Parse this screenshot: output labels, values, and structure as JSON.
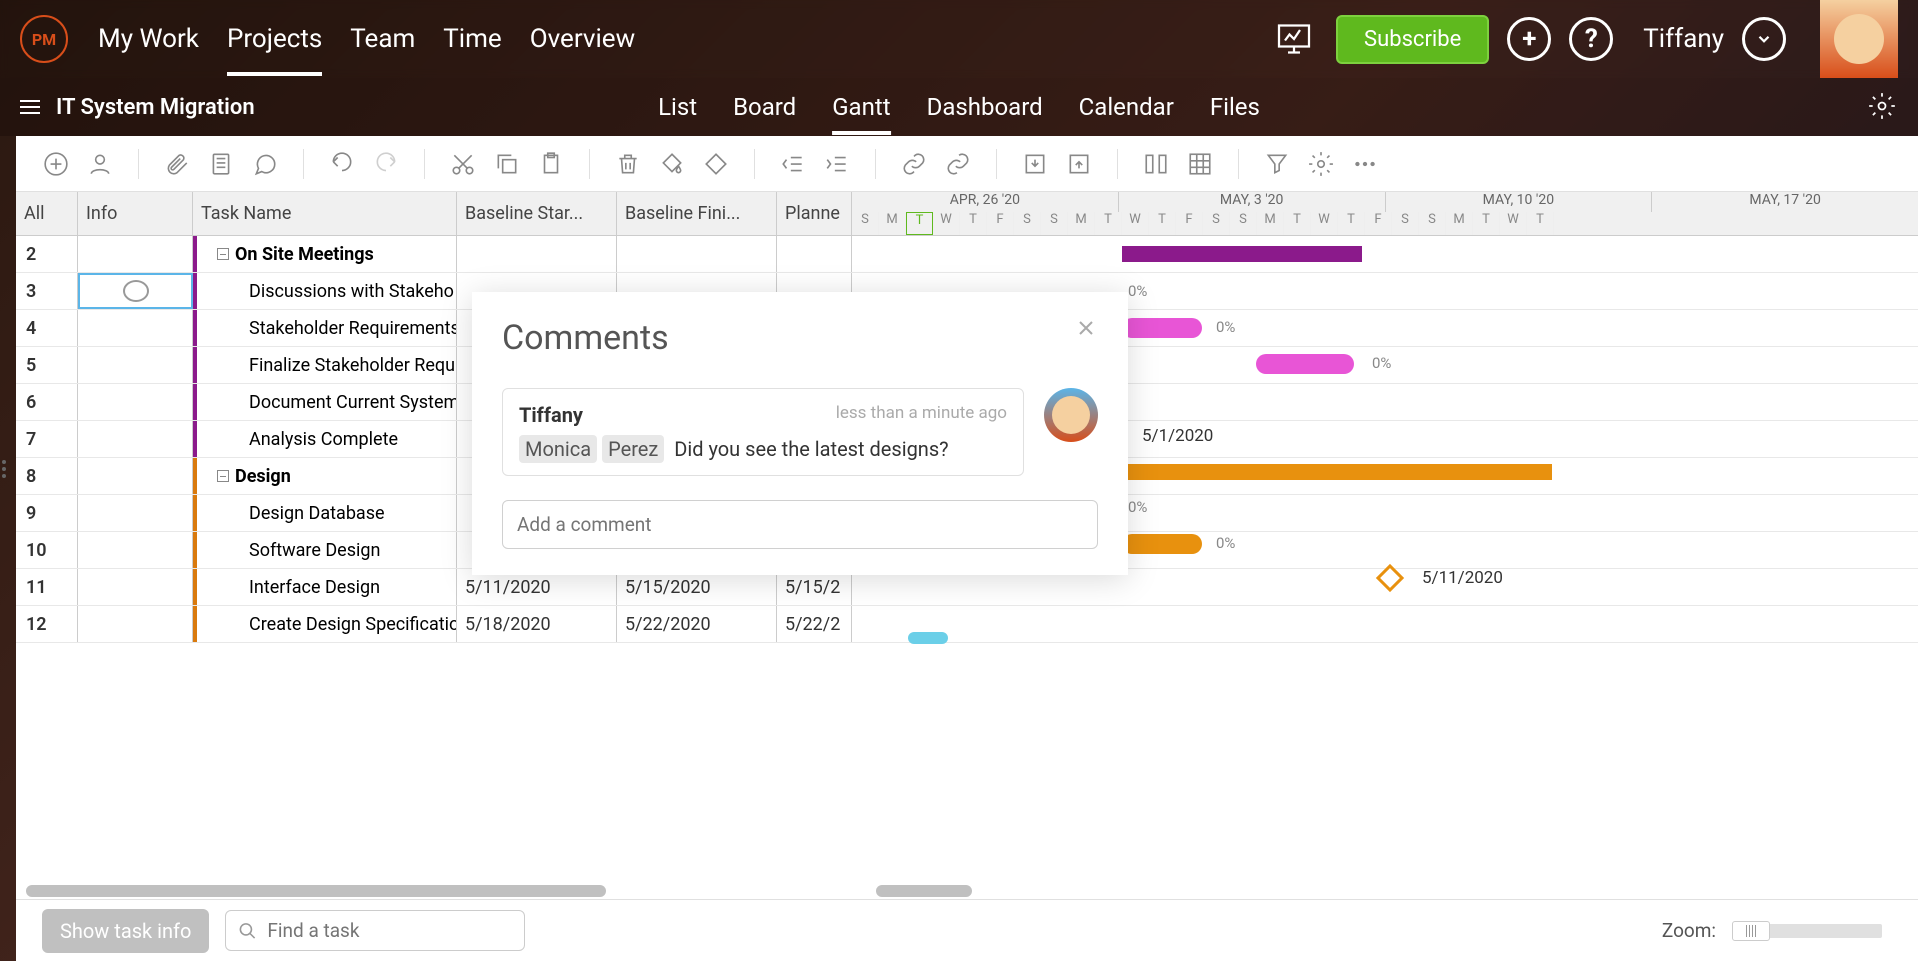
{
  "topNav": {
    "logo": "PM",
    "tabs": [
      "My Work",
      "Projects",
      "Team",
      "Time",
      "Overview"
    ],
    "activeTab": "Projects",
    "subscribe": "Subscribe",
    "userName": "Tiffany"
  },
  "subNav": {
    "projectName": "IT System Migration",
    "views": [
      "List",
      "Board",
      "Gantt",
      "Dashboard",
      "Calendar",
      "Files"
    ],
    "activeView": "Gantt"
  },
  "gridHeaders": {
    "all": "All",
    "info": "Info",
    "taskName": "Task Name",
    "baselineStart": "Baseline Star...",
    "baselineFinish": "Baseline Fini...",
    "planned": "Planne"
  },
  "ganttHeader": {
    "months": [
      "APR, 26 '20",
      "MAY, 3 '20",
      "MAY, 10 '20",
      "MAY, 17 '20"
    ],
    "days": [
      "S",
      "M",
      "T",
      "W",
      "T",
      "F",
      "S",
      "S",
      "M",
      "T",
      "W",
      "T",
      "F",
      "S",
      "S",
      "M",
      "T",
      "W",
      "T",
      "F",
      "S",
      "S",
      "M",
      "T",
      "W",
      "T"
    ]
  },
  "rows": [
    {
      "num": "2",
      "task": "On Site Meetings",
      "bold": true,
      "cat": "purple",
      "baselineStart": "",
      "baselineFinish": "",
      "planned": ""
    },
    {
      "num": "3",
      "task": "Discussions with Stakeho",
      "bold": false,
      "cat": "purple",
      "baselineStart": "",
      "baselineFinish": "",
      "planned": "",
      "selected": true
    },
    {
      "num": "4",
      "task": "Stakeholder Requirements",
      "bold": false,
      "cat": "purple",
      "baselineStart": "",
      "baselineFinish": "",
      "planned": ""
    },
    {
      "num": "5",
      "task": "Finalize Stakeholder Requ",
      "bold": false,
      "cat": "purple",
      "baselineStart": "",
      "baselineFinish": "",
      "planned": ""
    },
    {
      "num": "6",
      "task": "Document Current System",
      "bold": false,
      "cat": "purple",
      "baselineStart": "",
      "baselineFinish": "",
      "planned": ""
    },
    {
      "num": "7",
      "task": "Analysis Complete",
      "bold": false,
      "cat": "purple",
      "baselineStart": "",
      "baselineFinish": "",
      "planned": ""
    },
    {
      "num": "8",
      "task": "Design",
      "bold": true,
      "cat": "orange",
      "baselineStart": "",
      "baselineFinish": "",
      "planned": ""
    },
    {
      "num": "9",
      "task": "Design Database",
      "bold": false,
      "cat": "orange",
      "baselineStart": "",
      "baselineFinish": "",
      "planned": ""
    },
    {
      "num": "10",
      "task": "Software Design",
      "bold": false,
      "cat": "orange",
      "baselineStart": "",
      "baselineFinish": "",
      "planned": ""
    },
    {
      "num": "11",
      "task": "Interface Design",
      "bold": false,
      "cat": "orange",
      "baselineStart": "5/11/2020",
      "baselineFinish": "5/15/2020",
      "planned": "5/15/2"
    },
    {
      "num": "12",
      "task": "Create Design Specificatio",
      "bold": false,
      "cat": "orange",
      "baselineStart": "5/18/2020",
      "baselineFinish": "5/22/2020",
      "planned": "5/22/2"
    }
  ],
  "ganttBars": {
    "row3_pct": "0%",
    "row4_pct": "0%",
    "row5_pct": "0%",
    "row7_date": "5/1/2020",
    "row9_pct": "0%",
    "row10_pct": "0%",
    "row11_date": "5/11/2020"
  },
  "comments": {
    "title": "Comments",
    "author": "Tiffany",
    "time": "less than a minute ago",
    "mention1": "Monica",
    "mention2": "Perez",
    "text": "Did you see the latest designs?",
    "placeholder": "Add a comment"
  },
  "bottom": {
    "showTaskInfo": "Show task info",
    "findTask": "Find a task",
    "zoom": "Zoom:"
  }
}
